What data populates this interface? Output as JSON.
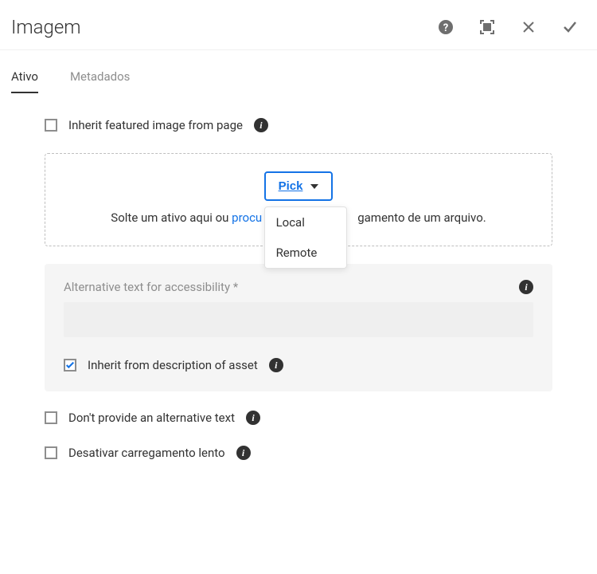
{
  "header": {
    "title": "Imagem"
  },
  "tabs": {
    "active": "Ativo",
    "other": "Metadados"
  },
  "inherit_featured": {
    "label": "Inherit featured image from page",
    "checked": false
  },
  "dropzone": {
    "pick_label": "Pick",
    "menu": {
      "local": "Local",
      "remote": "Remote"
    },
    "text_prefix": "Solte um ativo aqui ou ",
    "text_link": "procu",
    "text_suffix": "gamento de um arquivo."
  },
  "alt_panel": {
    "label": "Alternative text for accessibility *",
    "value": "",
    "inherit_label": "Inherit from description of asset",
    "inherit_checked": true
  },
  "no_alt": {
    "label": "Don't provide an alternative text",
    "checked": false
  },
  "lazy": {
    "label": "Desativar carregamento lento",
    "checked": false
  }
}
